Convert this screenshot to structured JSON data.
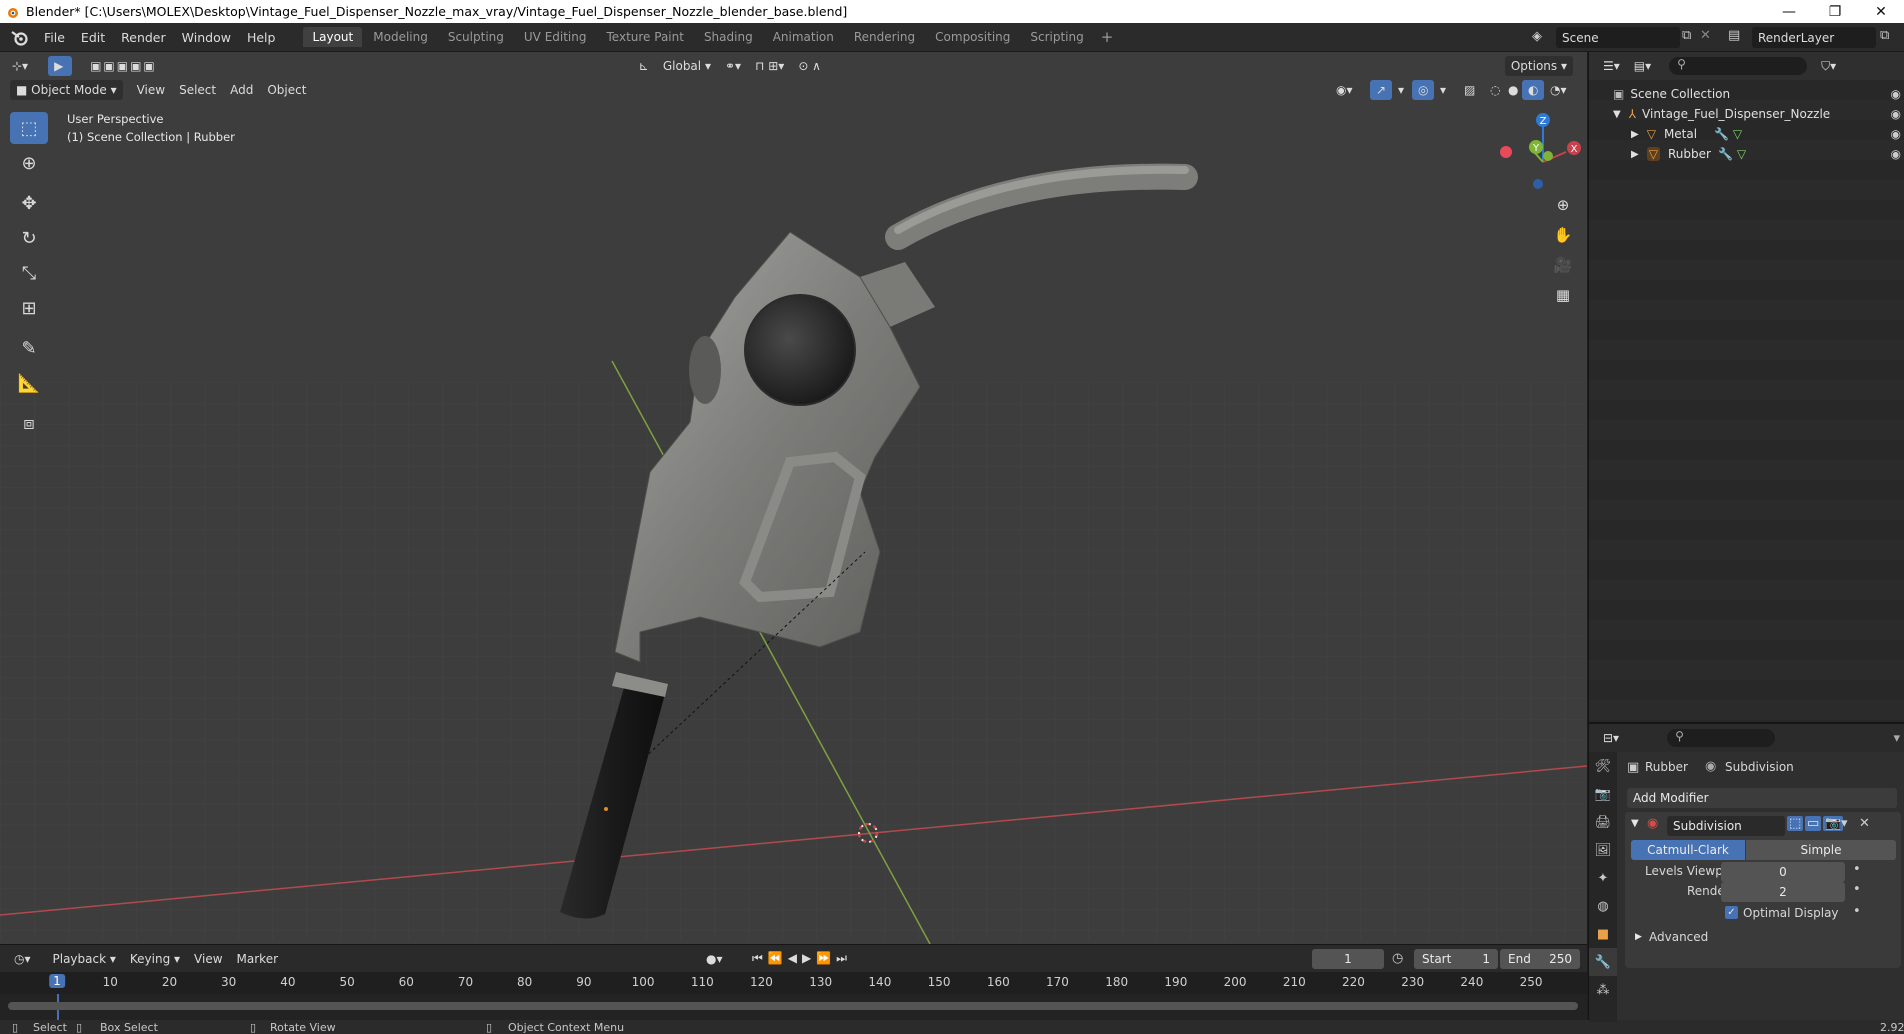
{
  "window": {
    "title": "Blender* [C:\\Users\\MOLEX\\Desktop\\Vintage_Fuel_Dispenser_Nozzle_max_vray/Vintage_Fuel_Dispenser_Nozzle_blender_base.blend]",
    "minimize": "—",
    "maximize": "❐",
    "close": "✕"
  },
  "menu": [
    "File",
    "Edit",
    "Render",
    "Window",
    "Help"
  ],
  "workspaces": [
    "Layout",
    "Modeling",
    "Sculpting",
    "UV Editing",
    "Texture Paint",
    "Shading",
    "Animation",
    "Rendering",
    "Compositing",
    "Scripting"
  ],
  "workspace_add": "+",
  "scene": {
    "name": "Scene",
    "render_layer": "RenderLayer"
  },
  "viewport": {
    "mode": "Object Mode",
    "menus": [
      "View",
      "Select",
      "Add",
      "Object"
    ],
    "transform_orientation": "Global",
    "options": "Options",
    "info_line1": "User Perspective",
    "info_line2": "(1) Scene Collection | Rubber",
    "gizmo": {
      "z": "Z",
      "y": "Y",
      "x": "X"
    }
  },
  "timeline": {
    "menus": [
      "Playback",
      "Keying",
      "View",
      "Marker"
    ],
    "current_frame": "1",
    "start_label": "Start",
    "start": "1",
    "end_label": "End",
    "end": "250",
    "ticks": [
      "10",
      "20",
      "30",
      "40",
      "50",
      "60",
      "70",
      "80",
      "90",
      "100",
      "110",
      "120",
      "130",
      "140",
      "150",
      "160",
      "170",
      "180",
      "190",
      "200",
      "210",
      "220",
      "230",
      "240",
      "250"
    ],
    "cursor_label": "1"
  },
  "status": {
    "select": "Select",
    "box_select": "Box Select",
    "rotate_view": "Rotate View",
    "context_menu": "Object Context Menu",
    "version": "2.92"
  },
  "outliner": {
    "root": "Scene Collection",
    "collection": "Vintage_Fuel_Dispenser_Nozzle",
    "objects": [
      "Metal",
      "Rubber"
    ]
  },
  "properties": {
    "object": "Rubber",
    "modifier_context": "Subdivision",
    "add_modifier": "Add Modifier",
    "modifier_name": "Subdivision",
    "type_options": [
      "Catmull-Clark",
      "Simple"
    ],
    "levels_viewport_label": "Levels Viewport",
    "levels_viewport": "0",
    "render_label": "Render",
    "render": "2",
    "optimal_display": "Optimal Display",
    "advanced": "Advanced"
  },
  "colors": {
    "accent": "#4772b3",
    "x_axis": "#c8424d",
    "y_axis": "#7fb536",
    "z_axis": "#2e7ad6",
    "viewport_bg": "#3d3d3d"
  }
}
